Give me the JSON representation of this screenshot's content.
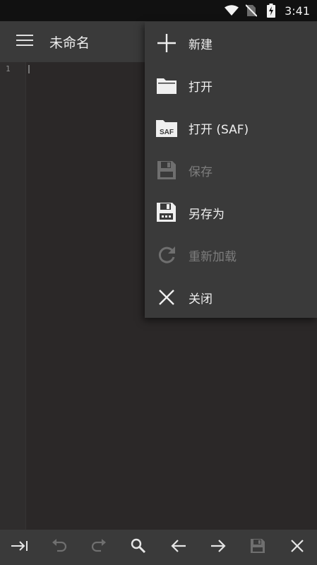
{
  "status_bar": {
    "time": "3:41",
    "icons": [
      "wifi-icon",
      "no-sim-icon",
      "battery-charging-icon"
    ]
  },
  "app_bar": {
    "title": "未命名",
    "menu_icon": "hamburger-menu-icon"
  },
  "editor": {
    "line_numbers": [
      "1"
    ]
  },
  "dropdown_menu": {
    "items": [
      {
        "label": "新建",
        "icon": "plus-icon",
        "enabled": true
      },
      {
        "label": "打开",
        "icon": "folder-icon",
        "enabled": true
      },
      {
        "label": "打开 (SAF)",
        "icon": "folder-saf-icon",
        "enabled": true
      },
      {
        "label": "保存",
        "icon": "save-icon",
        "enabled": false
      },
      {
        "label": "另存为",
        "icon": "save-as-icon",
        "enabled": true
      },
      {
        "label": "重新加载",
        "icon": "reload-icon",
        "enabled": false
      },
      {
        "label": "关闭",
        "icon": "close-icon",
        "enabled": true
      }
    ]
  },
  "bottom_toolbar": {
    "buttons": [
      {
        "icon": "tab-indent-icon",
        "enabled": true
      },
      {
        "icon": "undo-icon",
        "enabled": false
      },
      {
        "icon": "redo-icon",
        "enabled": false
      },
      {
        "icon": "search-icon",
        "enabled": true
      },
      {
        "icon": "arrow-left-icon",
        "enabled": true
      },
      {
        "icon": "arrow-right-icon",
        "enabled": true
      },
      {
        "icon": "save-icon",
        "enabled": false
      },
      {
        "icon": "close-icon",
        "enabled": true
      }
    ]
  },
  "colors": {
    "status_bar": "#111111",
    "app_bar": "#3a3a3a",
    "editor_background": "#2b2828",
    "menu_background": "#3a3a3a",
    "text": "#efefef",
    "disabled": "#7d7d7d"
  }
}
